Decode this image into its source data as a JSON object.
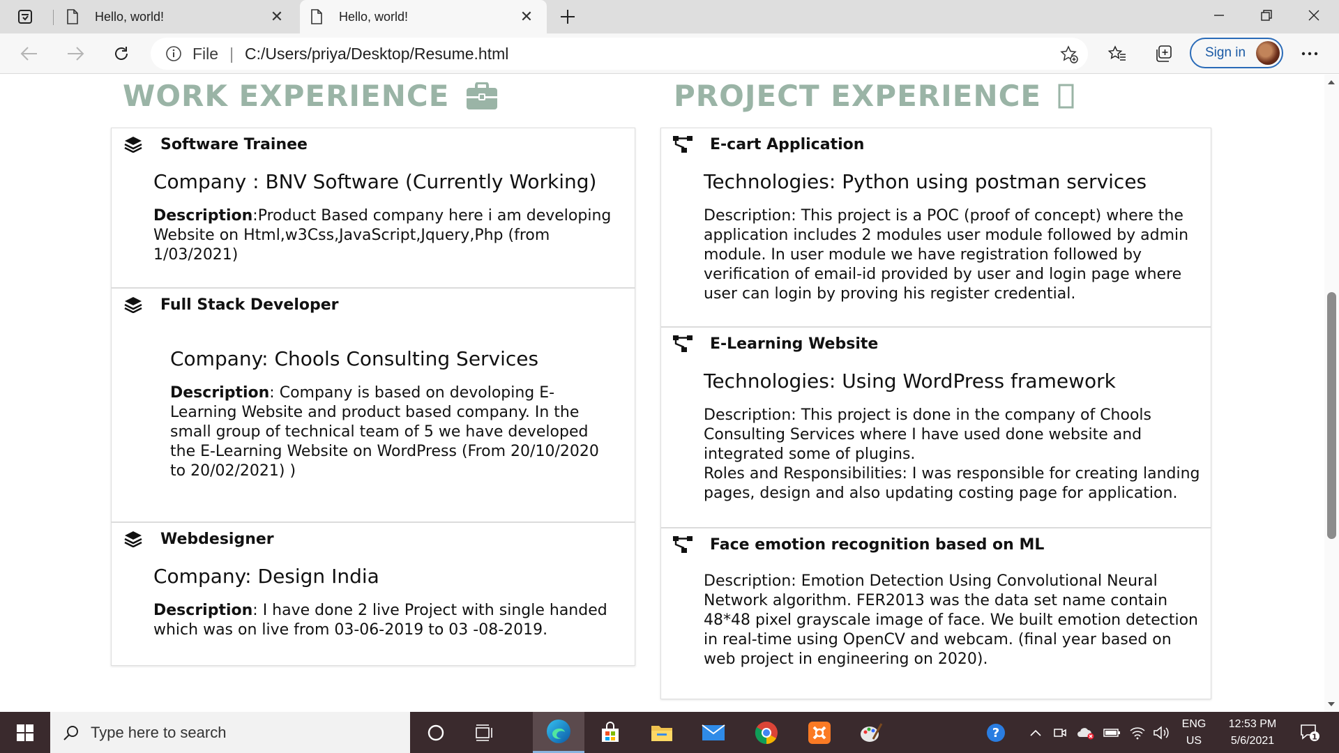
{
  "browser": {
    "tabs": [
      {
        "title": "Hello, world!",
        "active": false
      },
      {
        "title": "Hello, world!",
        "active": true
      }
    ],
    "address": {
      "protocol": "File",
      "url": "C:/Users/priya/Desktop/Resume.html"
    },
    "signin_label": "Sign in"
  },
  "page": {
    "work": {
      "heading": "WORK EXPERIENCE",
      "icon": "briefcase-icon",
      "items": [
        {
          "title": "Software Trainee",
          "company": "Company : BNV Software (Currently Working)",
          "desc_label": "Description",
          "desc_sep": ":",
          "desc_text": "Product Based company here i am developing Website on Html,w3Css,JavaScript,Jquery,Php (from 1/03/2021)"
        },
        {
          "title": "Full Stack Developer",
          "company": "Company: Chools Consulting Services",
          "desc_label": "Description",
          "desc_sep": ": ",
          "desc_text": "Company is based on devoloping E-Learning Website and product based company. In the small group of technical team of 5 we have developed the E-Learning Website on WordPress (From 20/10/2020 to 20/02/2021) )"
        },
        {
          "title": "Webdesigner",
          "company": "Company: Design India",
          "desc_label": "Description",
          "desc_sep": ": ",
          "desc_text": "I have done 2 live Project with single handed which was on live from 03-06-2019 to 03 -08-2019."
        }
      ]
    },
    "projects": {
      "heading": "PROJECT EXPERIENCE",
      "icon": "missing-glyph-icon",
      "items": [
        {
          "title": "E-cart Application",
          "tech": "Technologies: Python using postman services",
          "desc": "Description: This project is a POC (proof of concept) where the application includes 2 modules user module followed by admin module. In user module we have registration followed by verification of email-id provided by user and login page where user can login by proving his register credential."
        },
        {
          "title": "E-Learning Website",
          "tech": "Technologies: Using WordPress framework",
          "desc": "Description: This project is done in the company of Chools Consulting Services where I have used done website and integrated some of plugins.",
          "desc2": "Roles and Responsibilities: I was responsible for creating landing pages, design and also updating costing page for application."
        },
        {
          "title": "Face emotion recognition based on ML",
          "tech": "",
          "desc": "Description: Emotion Detection Using Convolutional Neural Network algorithm. FER2013 was the data set name contain 48*48 pixel grayscale image of face. We built emotion detection in real-time using OpenCV and webcam. (final year based on web project in engineering on 2020)."
        }
      ]
    }
  },
  "taskbar": {
    "search_placeholder": "Type here to search",
    "lang_top": "ENG",
    "lang_bottom": "US",
    "time": "12:53 PM",
    "date": "5/6/2021",
    "notification_count": "1"
  },
  "colors": {
    "heading": "#9ab4a6",
    "taskbar": "#3a2a2d",
    "accent": "#2a6bb8"
  }
}
